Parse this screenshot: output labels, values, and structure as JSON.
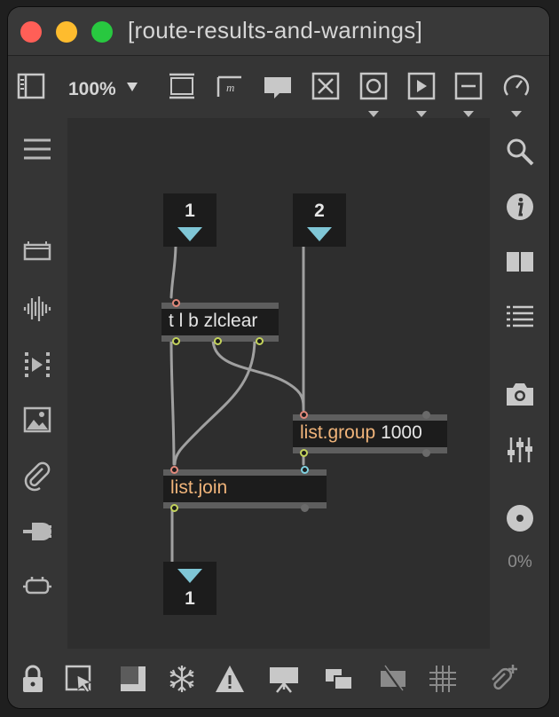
{
  "window": {
    "title": "[route-results-and-warnings]"
  },
  "toolbar": {
    "zoom_label": "100%",
    "icons": [
      "sidebar-toggle-icon",
      "presentation-frame-icon",
      "comment-box-icon",
      "speech-bubble-icon",
      "close-box-icon",
      "button-icon",
      "play-toggle-icon",
      "slider-icon",
      "dial-icon"
    ]
  },
  "left_sidebar": {
    "icons": [
      "menu-icon",
      "device-icon",
      "audio-waveform-icon",
      "video-clip-icon",
      "image-icon",
      "paperclip-icon",
      "plug-icon",
      "connector-icon"
    ]
  },
  "right_sidebar": {
    "icons": [
      "search-icon",
      "info-icon",
      "book-icon",
      "list-icon",
      "camera-icon",
      "mixer-icon",
      "cd-icon"
    ],
    "cpu_label": "0%"
  },
  "patch": {
    "inlet1_label": "1",
    "inlet2_label": "2",
    "outlet1_label": "1",
    "trigger_text": "t l b zlclear",
    "group_name": "list.group",
    "group_arg": "1000",
    "join_name": "list.join"
  },
  "bottombar": {
    "icons": [
      "lock-icon",
      "select-arrow-icon",
      "presentation-icon",
      "freeze-icon",
      "warning-icon",
      "projector-icon",
      "layer-icon",
      "hide-icon",
      "grid-icon",
      "attach-icon"
    ]
  },
  "colors": {
    "background": "#353535",
    "canvas": "#2e2e2e",
    "object": "#1c1c1c",
    "object_name": "#f0b47a",
    "inlet": "#e2897b",
    "outlet": "#c4d35b",
    "io_triangle": "#7fc6d6",
    "patch_cord": "#a0a0a0"
  }
}
